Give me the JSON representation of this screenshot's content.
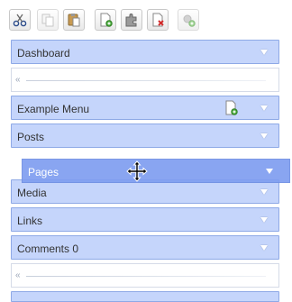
{
  "toolbar": {
    "buttons": [
      {
        "name": "cut-button",
        "icon": "scissors-icon",
        "enabled": true
      },
      {
        "name": "copy-button",
        "icon": "copy-icon",
        "enabled": false
      },
      {
        "name": "paste-button",
        "icon": "paste-icon",
        "enabled": true
      },
      {
        "name": "new-item-button",
        "icon": "new-document-icon",
        "enabled": true
      },
      {
        "name": "add-module-button",
        "icon": "puzzle-icon",
        "enabled": true
      },
      {
        "name": "delete-button",
        "icon": "delete-document-icon",
        "enabled": true
      },
      {
        "name": "add-widget-button",
        "icon": "add-gear-icon",
        "enabled": true
      }
    ]
  },
  "menu": {
    "items": [
      {
        "label": "Dashboard"
      },
      {
        "label": "Example Menu",
        "has_add_icon": true
      },
      {
        "label": "Posts"
      },
      {
        "label": "Media"
      },
      {
        "label": "Links"
      },
      {
        "label": "Comments 0"
      }
    ],
    "slider_glyph": "«"
  },
  "dragging": {
    "label": "Pages",
    "cursor": "move-cursor-icon"
  },
  "colors": {
    "bar_bg": "#c5d5fb",
    "bar_border": "#8ea9e6",
    "drag_bg": "#7f9ef0"
  }
}
